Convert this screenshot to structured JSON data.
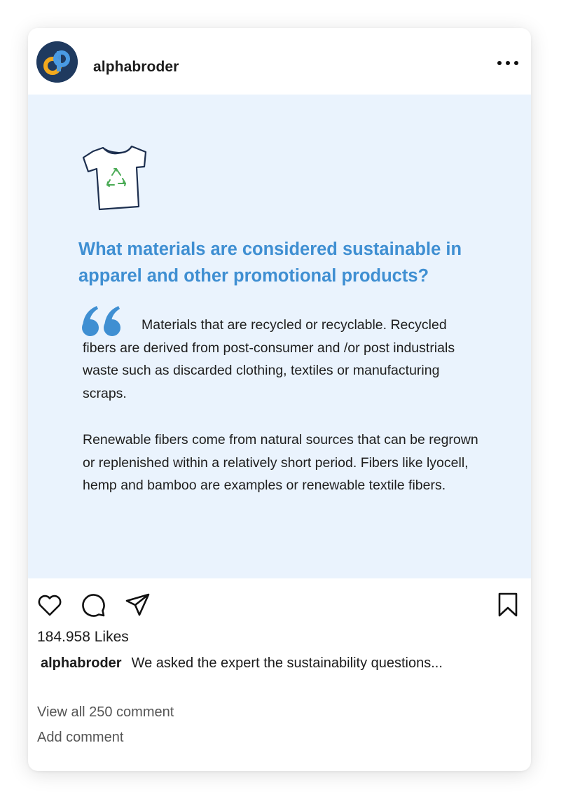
{
  "post_header": {
    "username": "alphabroder",
    "avatar_icon": "alphabroder-logo",
    "more_icon": "more-options-icon"
  },
  "post_image": {
    "background_color": "#eaf3fd",
    "icon": "recycled-tshirt-icon",
    "question": "What materials are considered sustainable in apparel and other promotional products?",
    "quote_icon": "quote-mark-icon",
    "paragraph_1": "Materials that are recycled or recyclable. Recycled fibers are derived from post-consumer and /or post industrials waste such as discarded clothing, textiles or manufacturing scraps.",
    "paragraph_2": "Renewable fibers come from natural sources that can be regrown or replenished within a relatively short period. Fibers like lyocell, hemp and bamboo are examples or renewable textile fibers.",
    "accent_color": "#3f8fd2"
  },
  "actions": {
    "like_icon": "heart-icon",
    "comment_icon": "comment-icon",
    "share_icon": "send-icon",
    "save_icon": "bookmark-icon"
  },
  "engagement": {
    "likes": "184.958 Likes",
    "caption_username": "alphabroder",
    "caption_text": "We asked the expert the sustainability questions...",
    "view_all_comments": "View all 250 comment",
    "add_comment_placeholder": "Add comment"
  }
}
